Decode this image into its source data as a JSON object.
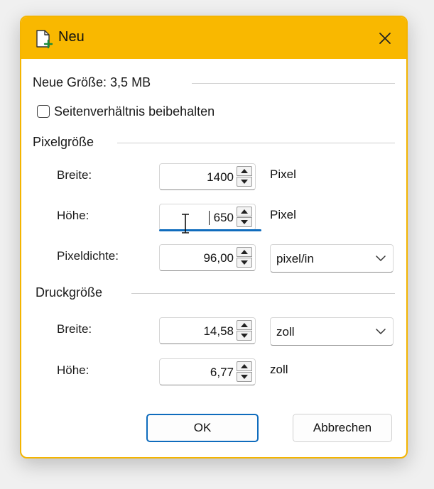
{
  "dialog": {
    "title": "Neu",
    "close_glyph": "✕",
    "new_size_label": "Neue Größe: 3,5 MB",
    "keep_ratio_label": "Seitenverhältnis beibehalten",
    "keep_ratio_checked": false
  },
  "pixel_size": {
    "heading": "Pixelgröße",
    "width_label": "Breite:",
    "width_value": "1400",
    "width_unit": "Pixel",
    "height_label": "Höhe:",
    "height_value": "650",
    "height_unit": "Pixel",
    "density_label": "Pixeldichte:",
    "density_value": "96,00",
    "density_unit": "pixel/in"
  },
  "print_size": {
    "heading": "Druckgröße",
    "width_label": "Breite:",
    "width_value": "14,58",
    "width_unit": "zoll",
    "height_label": "Höhe:",
    "height_value": "6,77",
    "height_unit": "zoll"
  },
  "buttons": {
    "ok": "OK",
    "cancel": "Abbrechen"
  },
  "colors": {
    "titlebar": "#f9b800",
    "accent": "#0f6cbd"
  },
  "icons": {
    "title": "new-document-icon",
    "close": "close-icon",
    "spin_up": "arrow-up-icon",
    "spin_down": "arrow-down-icon",
    "dropdown": "chevron-down-icon"
  }
}
